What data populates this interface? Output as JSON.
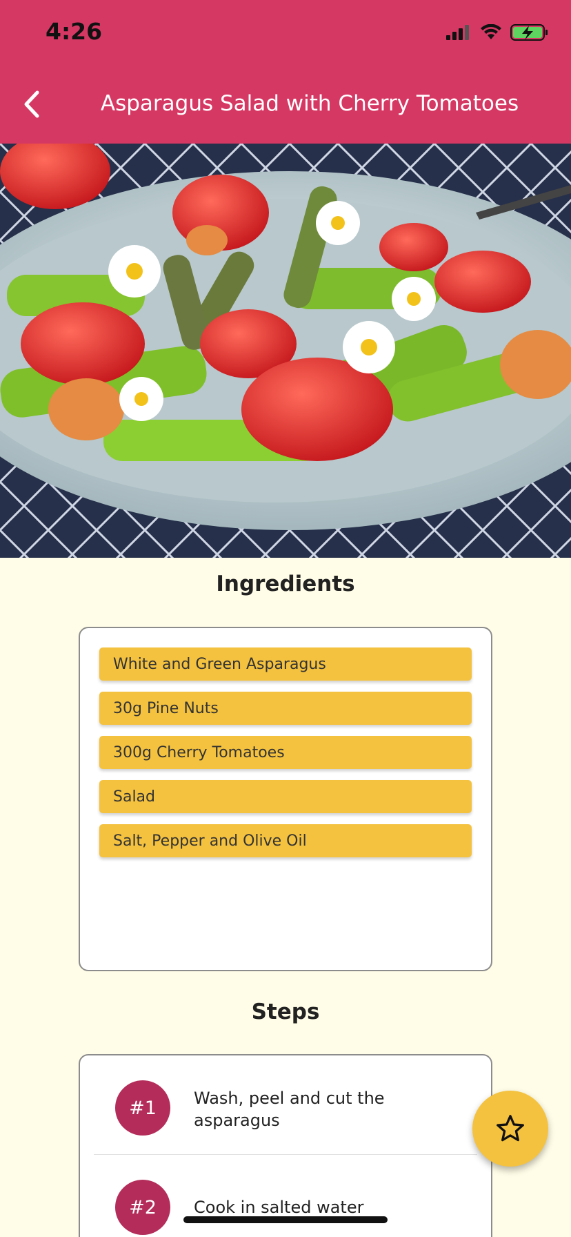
{
  "status_bar": {
    "time": "4:26"
  },
  "header": {
    "title": "Asparagus Salad with Cherry Tomatoes"
  },
  "ingredients": {
    "heading": "Ingredients",
    "items": [
      "White and Green Asparagus",
      "30g Pine Nuts",
      "300g Cherry Tomatoes",
      "Salad",
      "Salt, Pepper and Olive Oil"
    ]
  },
  "steps": {
    "heading": "Steps",
    "items": [
      {
        "number": "#1",
        "text": "Wash, peel and cut the asparagus"
      },
      {
        "number": "#2",
        "text": "Cook in salted water"
      }
    ]
  },
  "colors": {
    "app_bar": "#d63864",
    "background": "#fffde7",
    "ingredient_chip": "#f4c23f",
    "step_badge": "#b32c5a",
    "fab": "#f4c23f"
  },
  "icons": {
    "back": "chevron-left-icon",
    "favorite": "star-outline-icon",
    "signal": "signal-icon",
    "wifi": "wifi-icon",
    "battery": "battery-charging-icon"
  }
}
